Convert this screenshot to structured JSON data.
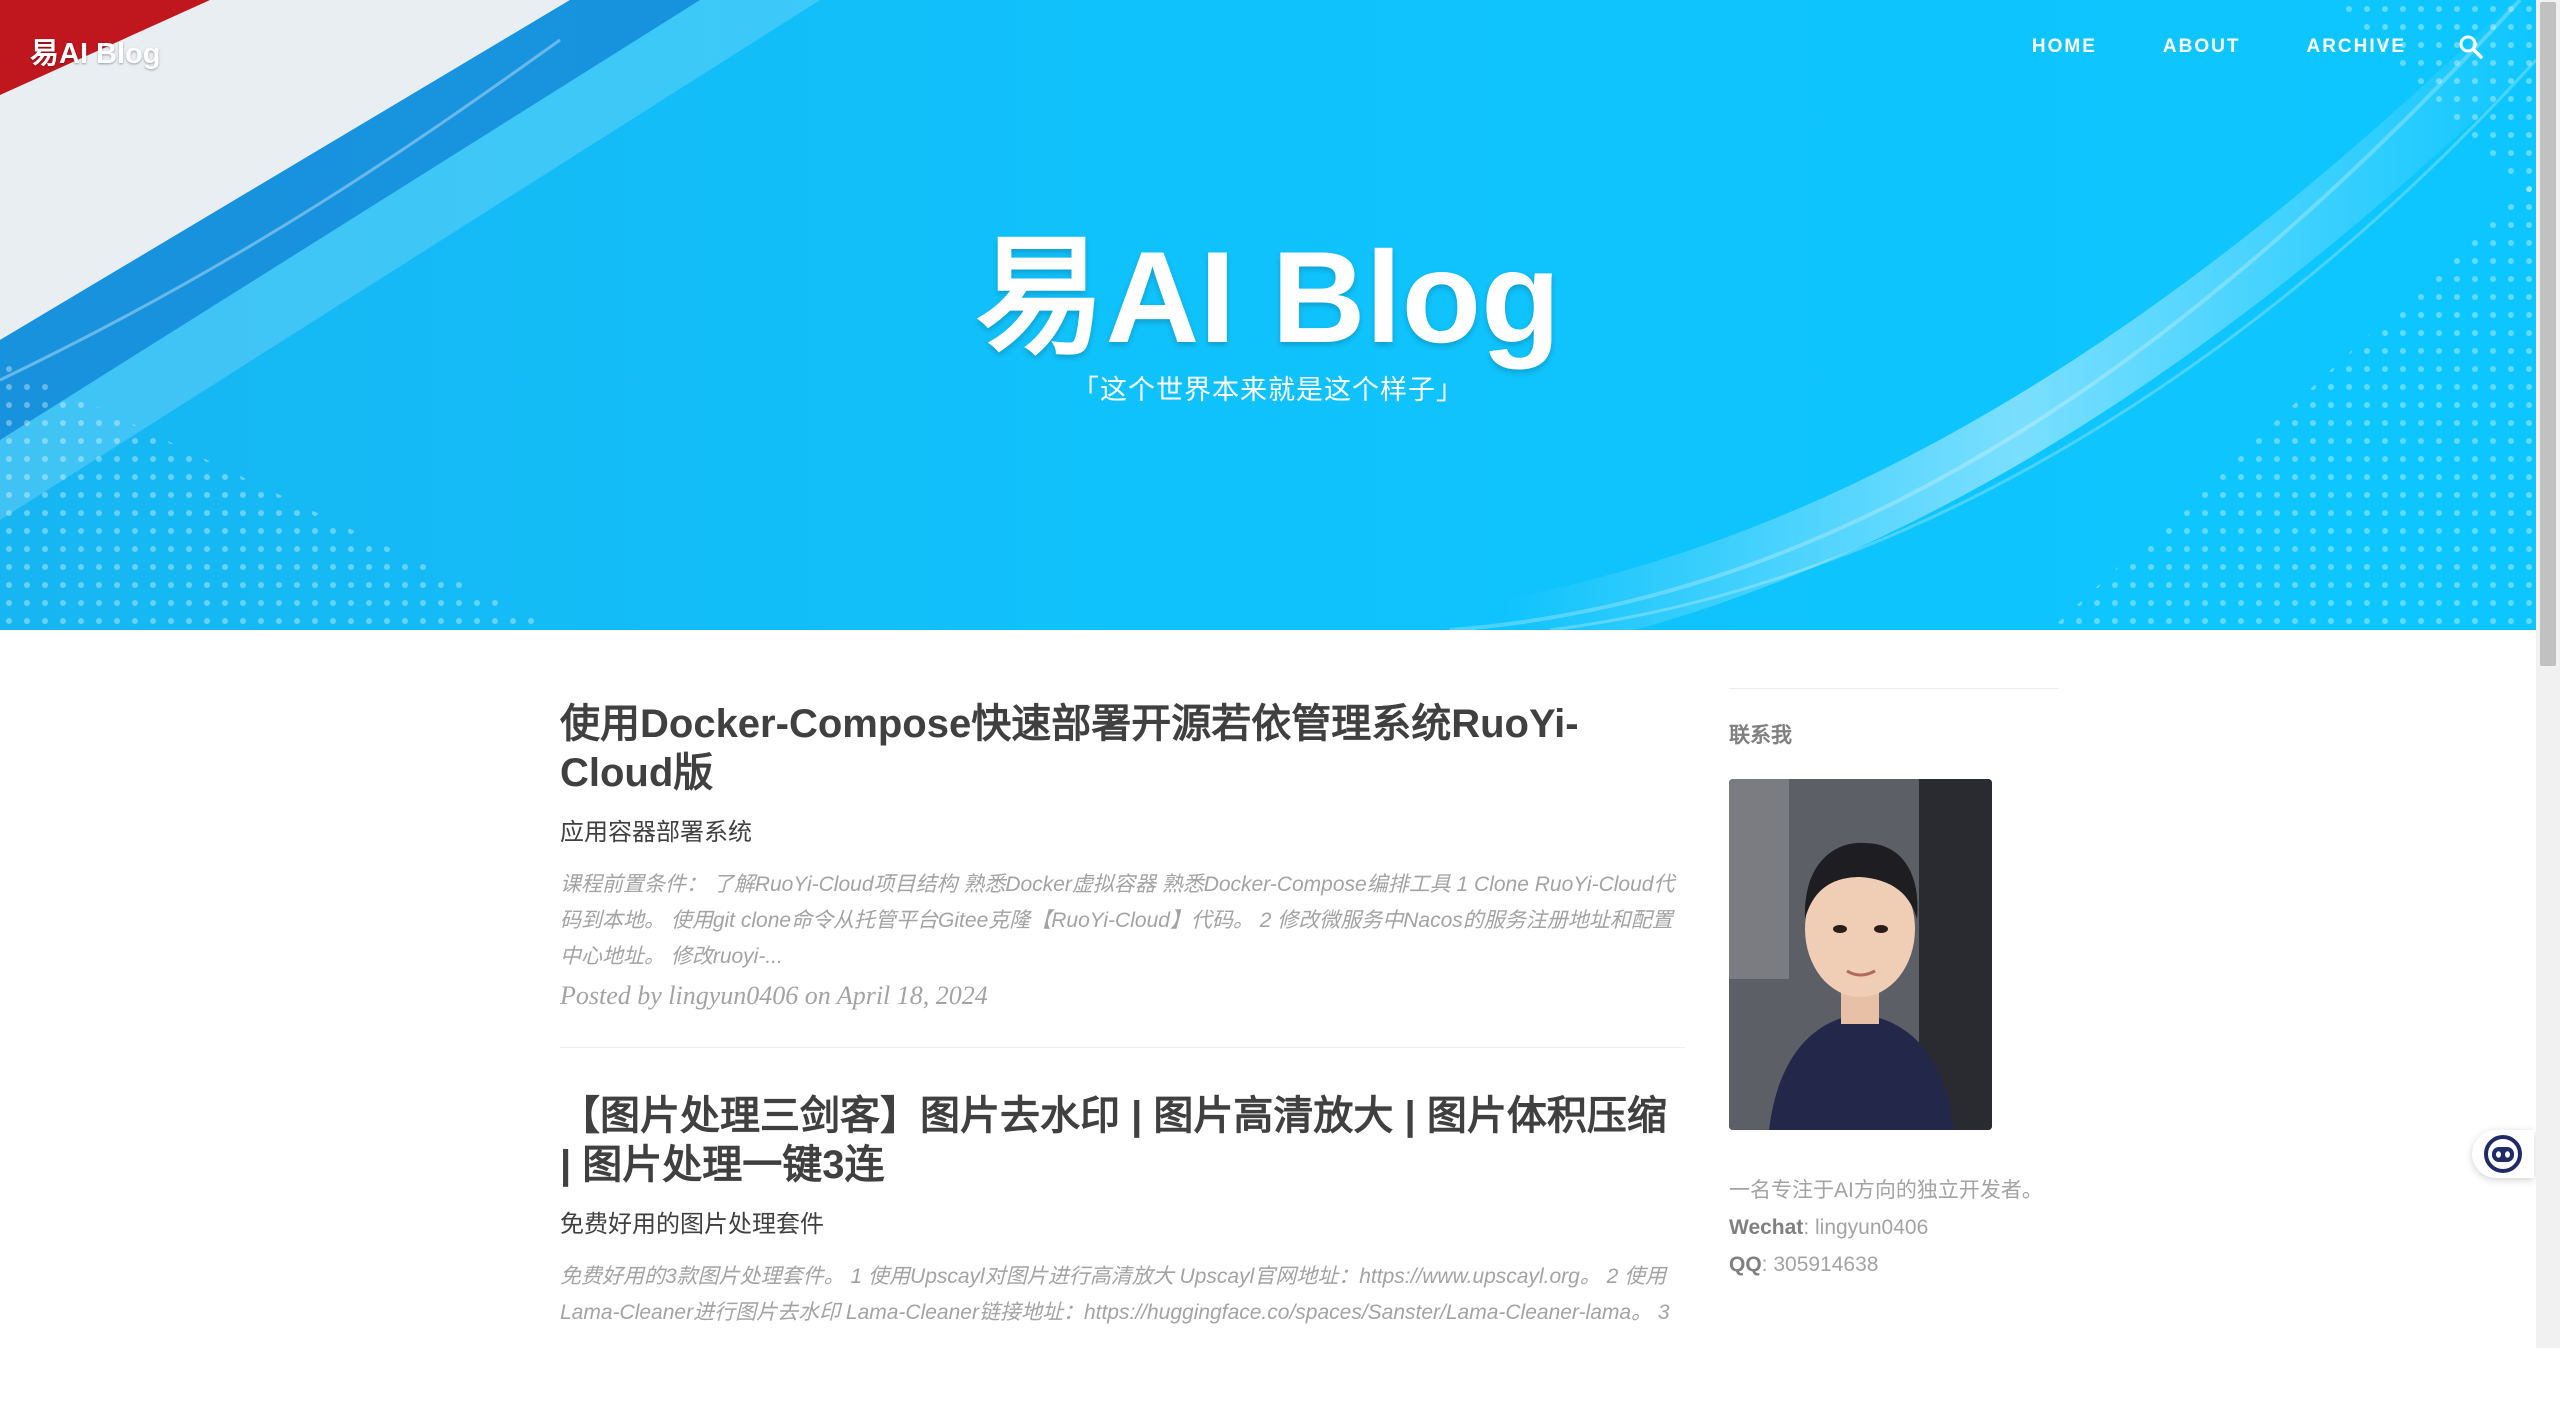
{
  "header": {
    "brand": "易AI Blog",
    "nav": [
      {
        "label": "HOME"
      },
      {
        "label": "ABOUT"
      },
      {
        "label": "ARCHIVE"
      }
    ],
    "search_icon": "search-icon"
  },
  "hero": {
    "title": "易AI Blog",
    "subtitle": "「这个世界本来就是这个样子」"
  },
  "posts": [
    {
      "title": "使用Docker-Compose快速部署开源若依管理系统RuoYi-Cloud版",
      "subtitle": "应用容器部署系统",
      "excerpt": "课程前置条件： 了解RuoYi-Cloud项目结构 熟悉Docker虚拟容器 熟悉Docker-Compose编排工具 1 Clone RuoYi-Cloud代码到本地。 使用git clone命令从托管平台Gitee克隆【RuoYi-Cloud】代码。 2 修改微服务中Nacos的服务注册地址和配置中心地址。 修改ruoyi-...",
      "meta": "Posted by lingyun0406 on April 18, 2024"
    },
    {
      "title": "【图片处理三剑客】图片去水印 | 图片高清放大 | 图片体积压缩 | 图片处理一键3连",
      "subtitle": "免费好用的图片处理套件",
      "excerpt": "免费好用的3款图片处理套件。 1 使用Upscayl对图片进行高清放大 Upscayl官网地址：https://www.upscayl.org。 2 使用Lama-Cleaner进行图片去水印 Lama-Cleaner链接地址：https://huggingface.co/spaces/Sanster/Lama-Cleaner-lama。 3"
    }
  ],
  "sidebar": {
    "heading": "联系我",
    "description": "一名专注于AI方向的独立开发者。",
    "wechat_label": "Wechat",
    "wechat_value": ": lingyun0406",
    "qq_label": "QQ",
    "qq_value": ": 305914638"
  },
  "colors": {
    "hero_blue": "#0dc6ff",
    "text_dark": "#404040",
    "text_muted": "#a3a3a3"
  },
  "float_button_icon": "chat-bot-icon"
}
